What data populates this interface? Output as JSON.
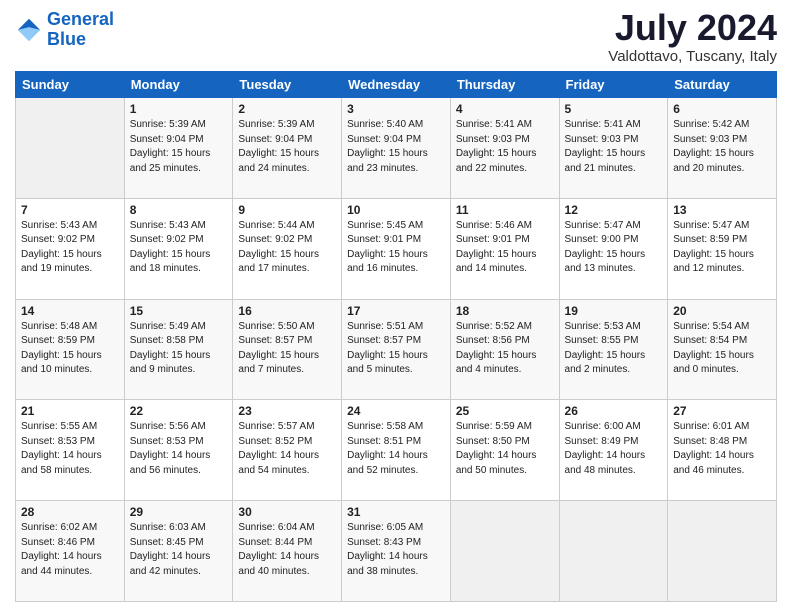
{
  "logo": {
    "line1": "General",
    "line2": "Blue"
  },
  "title": "July 2024",
  "location": "Valdottavo, Tuscany, Italy",
  "headers": [
    "Sunday",
    "Monday",
    "Tuesday",
    "Wednesday",
    "Thursday",
    "Friday",
    "Saturday"
  ],
  "weeks": [
    [
      {
        "day": "",
        "text": ""
      },
      {
        "day": "1",
        "text": "Sunrise: 5:39 AM\nSunset: 9:04 PM\nDaylight: 15 hours\nand 25 minutes."
      },
      {
        "day": "2",
        "text": "Sunrise: 5:39 AM\nSunset: 9:04 PM\nDaylight: 15 hours\nand 24 minutes."
      },
      {
        "day": "3",
        "text": "Sunrise: 5:40 AM\nSunset: 9:04 PM\nDaylight: 15 hours\nand 23 minutes."
      },
      {
        "day": "4",
        "text": "Sunrise: 5:41 AM\nSunset: 9:03 PM\nDaylight: 15 hours\nand 22 minutes."
      },
      {
        "day": "5",
        "text": "Sunrise: 5:41 AM\nSunset: 9:03 PM\nDaylight: 15 hours\nand 21 minutes."
      },
      {
        "day": "6",
        "text": "Sunrise: 5:42 AM\nSunset: 9:03 PM\nDaylight: 15 hours\nand 20 minutes."
      }
    ],
    [
      {
        "day": "7",
        "text": "Sunrise: 5:43 AM\nSunset: 9:02 PM\nDaylight: 15 hours\nand 19 minutes."
      },
      {
        "day": "8",
        "text": "Sunrise: 5:43 AM\nSunset: 9:02 PM\nDaylight: 15 hours\nand 18 minutes."
      },
      {
        "day": "9",
        "text": "Sunrise: 5:44 AM\nSunset: 9:02 PM\nDaylight: 15 hours\nand 17 minutes."
      },
      {
        "day": "10",
        "text": "Sunrise: 5:45 AM\nSunset: 9:01 PM\nDaylight: 15 hours\nand 16 minutes."
      },
      {
        "day": "11",
        "text": "Sunrise: 5:46 AM\nSunset: 9:01 PM\nDaylight: 15 hours\nand 14 minutes."
      },
      {
        "day": "12",
        "text": "Sunrise: 5:47 AM\nSunset: 9:00 PM\nDaylight: 15 hours\nand 13 minutes."
      },
      {
        "day": "13",
        "text": "Sunrise: 5:47 AM\nSunset: 8:59 PM\nDaylight: 15 hours\nand 12 minutes."
      }
    ],
    [
      {
        "day": "14",
        "text": "Sunrise: 5:48 AM\nSunset: 8:59 PM\nDaylight: 15 hours\nand 10 minutes."
      },
      {
        "day": "15",
        "text": "Sunrise: 5:49 AM\nSunset: 8:58 PM\nDaylight: 15 hours\nand 9 minutes."
      },
      {
        "day": "16",
        "text": "Sunrise: 5:50 AM\nSunset: 8:57 PM\nDaylight: 15 hours\nand 7 minutes."
      },
      {
        "day": "17",
        "text": "Sunrise: 5:51 AM\nSunset: 8:57 PM\nDaylight: 15 hours\nand 5 minutes."
      },
      {
        "day": "18",
        "text": "Sunrise: 5:52 AM\nSunset: 8:56 PM\nDaylight: 15 hours\nand 4 minutes."
      },
      {
        "day": "19",
        "text": "Sunrise: 5:53 AM\nSunset: 8:55 PM\nDaylight: 15 hours\nand 2 minutes."
      },
      {
        "day": "20",
        "text": "Sunrise: 5:54 AM\nSunset: 8:54 PM\nDaylight: 15 hours\nand 0 minutes."
      }
    ],
    [
      {
        "day": "21",
        "text": "Sunrise: 5:55 AM\nSunset: 8:53 PM\nDaylight: 14 hours\nand 58 minutes."
      },
      {
        "day": "22",
        "text": "Sunrise: 5:56 AM\nSunset: 8:53 PM\nDaylight: 14 hours\nand 56 minutes."
      },
      {
        "day": "23",
        "text": "Sunrise: 5:57 AM\nSunset: 8:52 PM\nDaylight: 14 hours\nand 54 minutes."
      },
      {
        "day": "24",
        "text": "Sunrise: 5:58 AM\nSunset: 8:51 PM\nDaylight: 14 hours\nand 52 minutes."
      },
      {
        "day": "25",
        "text": "Sunrise: 5:59 AM\nSunset: 8:50 PM\nDaylight: 14 hours\nand 50 minutes."
      },
      {
        "day": "26",
        "text": "Sunrise: 6:00 AM\nSunset: 8:49 PM\nDaylight: 14 hours\nand 48 minutes."
      },
      {
        "day": "27",
        "text": "Sunrise: 6:01 AM\nSunset: 8:48 PM\nDaylight: 14 hours\nand 46 minutes."
      }
    ],
    [
      {
        "day": "28",
        "text": "Sunrise: 6:02 AM\nSunset: 8:46 PM\nDaylight: 14 hours\nand 44 minutes."
      },
      {
        "day": "29",
        "text": "Sunrise: 6:03 AM\nSunset: 8:45 PM\nDaylight: 14 hours\nand 42 minutes."
      },
      {
        "day": "30",
        "text": "Sunrise: 6:04 AM\nSunset: 8:44 PM\nDaylight: 14 hours\nand 40 minutes."
      },
      {
        "day": "31",
        "text": "Sunrise: 6:05 AM\nSunset: 8:43 PM\nDaylight: 14 hours\nand 38 minutes."
      },
      {
        "day": "",
        "text": ""
      },
      {
        "day": "",
        "text": ""
      },
      {
        "day": "",
        "text": ""
      }
    ]
  ]
}
